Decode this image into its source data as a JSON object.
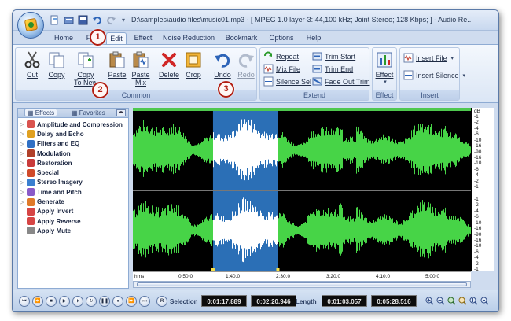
{
  "window": {
    "title": "D:\\samples\\audio files\\music01.mp3 - [ MPEG 1.0 layer-3: 44,100 kHz; Joint Stereo; 128 Kbps; ] - Audio Re..."
  },
  "tabs": [
    {
      "label": "Home"
    },
    {
      "label": "File"
    },
    {
      "label": "Edit"
    },
    {
      "label": "Effect"
    },
    {
      "label": "Noise Reduction"
    },
    {
      "label": "Bookmark"
    },
    {
      "label": "Options"
    },
    {
      "label": "Help"
    }
  ],
  "ribbon": {
    "common": {
      "label": "Common",
      "cut": "Cut",
      "copy": "Copy",
      "copy_to_new_1": "Copy",
      "copy_to_new_2": "To New",
      "paste": "Paste",
      "paste_mix_1": "Paste",
      "paste_mix_2": "Mix",
      "delete": "Delete",
      "crop": "Crop",
      "undo": "Undo",
      "redo": "Redo"
    },
    "extend": {
      "label": "Extend",
      "repeat": "Repeat",
      "mix_file": "Mix File",
      "silence_sel": "Silence Sel",
      "trim_start": "Trim Start",
      "trim_end": "Trim End",
      "fade_out_trim": "Fade Out Trim"
    },
    "effect": {
      "label": "Effect",
      "button": "Effect"
    },
    "insert": {
      "label": "Insert",
      "insert_file": "Insert File",
      "insert_silence": "Insert Silence"
    }
  },
  "callouts": [
    "1",
    "2",
    "3"
  ],
  "panel": {
    "tab_effects": "Effects",
    "tab_favorites": "Favorites",
    "items": [
      {
        "label": "Amplitude and Compression",
        "color": "#d9534f"
      },
      {
        "label": "Delay and Echo",
        "color": "#e0a020"
      },
      {
        "label": "Filters and EQ",
        "color": "#2f6fc4"
      },
      {
        "label": "Modulation",
        "color": "#b0402a"
      },
      {
        "label": "Restoration",
        "color": "#c93b3b"
      },
      {
        "label": "Special",
        "color": "#d04a2a"
      },
      {
        "label": "Stereo Imagery",
        "color": "#3a7fd0"
      },
      {
        "label": "Time and Pitch",
        "color": "#8a5ac8"
      },
      {
        "label": "Generate",
        "color": "#e07a2a"
      },
      {
        "label": "Apply Invert",
        "color": "#d64545"
      },
      {
        "label": "Apply Reverse",
        "color": "#d64545"
      },
      {
        "label": "Apply Mute",
        "color": "#888888"
      }
    ]
  },
  "db_scale": {
    "unit": "dB",
    "top_channel": [
      "-1",
      "-2",
      "-4",
      "-6",
      "-10",
      "-16",
      "-90",
      "-16",
      "-10",
      "-6",
      "-4",
      "-2",
      "-1"
    ],
    "bottom_channel": [
      "-1",
      "-2",
      "-4",
      "-6",
      "-10",
      "-16",
      "-90",
      "-16",
      "-10",
      "-6",
      "-4",
      "-2",
      "-1"
    ]
  },
  "timeline": {
    "labels": [
      "hms",
      "0:50.0",
      "1:40.0",
      "2:30.0",
      "3:20.0",
      "4:10.0",
      "5:00.0"
    ]
  },
  "statusbar": {
    "repeat_button": "R",
    "selection_label": "Selection",
    "selection_start": "0:01:17.889",
    "selection_end": "0:02:20.946",
    "length_label": "Length",
    "length_selected": "0:01:03.057",
    "length_total": "0:05:28.516"
  },
  "colors": {
    "waveform": "#47d447",
    "selection_bg": "#2b6fb6",
    "selected_wave": "#ffffff",
    "callout": "#b21e12"
  }
}
